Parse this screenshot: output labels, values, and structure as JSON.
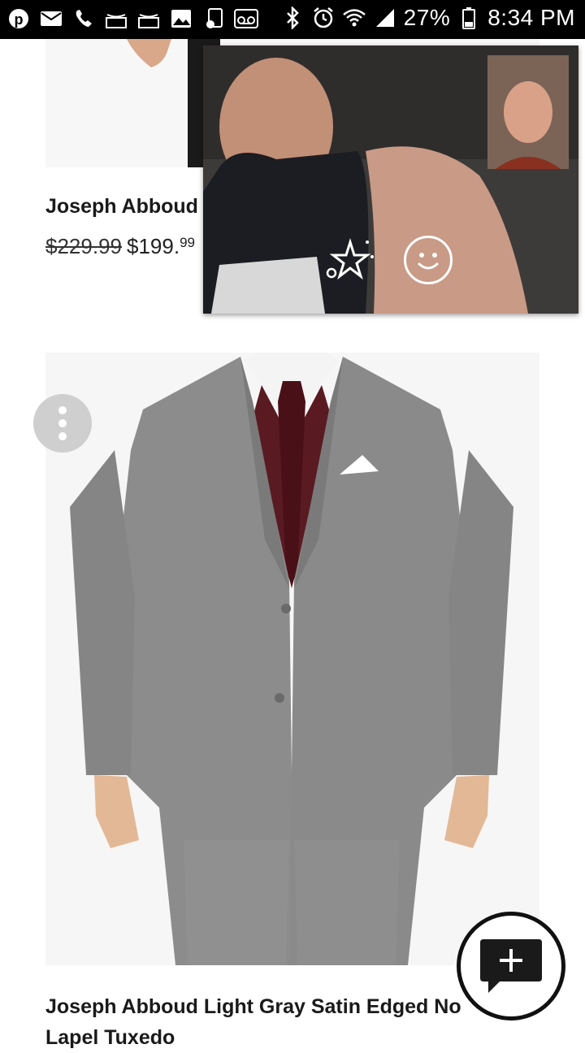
{
  "status_bar": {
    "battery_percent": "27%",
    "time": "8:34 PM",
    "left_icons": [
      "pinterest-icon",
      "mail-icon",
      "phone-icon",
      "amazon-icon",
      "amazon-icon",
      "gallery-icon",
      "music-icon",
      "voicemail-icon"
    ],
    "right_icons": [
      "bluetooth-icon",
      "alarm-icon",
      "wifi-icon",
      "signal-icon",
      "battery-icon"
    ]
  },
  "products": [
    {
      "title": "Joseph Abboud",
      "old_price": "$229.99",
      "new_price_main": "$199.",
      "new_price_cents": "99"
    },
    {
      "title": "Joseph Abboud Light Gray Satin Edged No Lapel Tuxedo"
    }
  ],
  "colors": {
    "suit_gray": "#8c8c8c",
    "vest_burgundy": "#5a1a22",
    "fab_border": "#111111"
  }
}
